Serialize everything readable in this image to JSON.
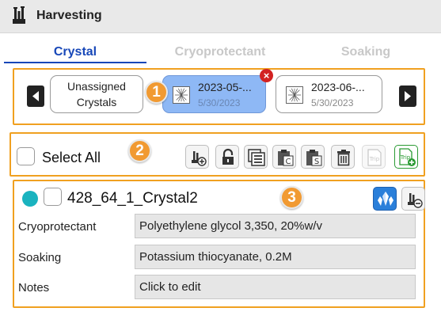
{
  "window": {
    "title": "Harvesting",
    "app_icon": "flask-rack-icon"
  },
  "tabs": [
    {
      "label": "Crystal",
      "active": true
    },
    {
      "label": "Cryoprotectant",
      "active": false
    },
    {
      "label": "Soaking",
      "active": false
    }
  ],
  "accent_color": "#1747b8",
  "callout_color": "#f19a32",
  "carousel": {
    "callout": "1",
    "cards": [
      {
        "name_line1": "Unassigned",
        "name_line2": "Crystals",
        "selected": false
      },
      {
        "name": "2023-05-...",
        "date": "5/30/2023",
        "selected": true,
        "remove": "×"
      },
      {
        "name": "2023-06-...",
        "date": "5/30/2023",
        "selected": false
      }
    ]
  },
  "toolbar": {
    "callout": "2",
    "select_all_label": "Select All",
    "tools": [
      {
        "icon": "add-crystal-icon",
        "enabled": true
      },
      {
        "icon": "lock-icon",
        "enabled": true
      },
      {
        "icon": "copy-list-icon",
        "enabled": true
      },
      {
        "icon": "clipboard-c-icon",
        "enabled": true
      },
      {
        "icon": "clipboard-s-icon",
        "enabled": true
      },
      {
        "icon": "trash-icon",
        "enabled": true
      },
      {
        "icon": "trip-icon",
        "label": "Trip",
        "enabled": false
      },
      {
        "icon": "add-trip-icon",
        "label": "Trip",
        "enabled": true
      }
    ]
  },
  "crystal": {
    "callout": "3",
    "name": "428_64_1_Crystal2",
    "status_color": "#1ab3bf",
    "fields": [
      {
        "label": "Cryoprotectant",
        "value": "Polyethylene glycol 3,350, 20%w/v"
      },
      {
        "label": "Soaking",
        "value": "Potassium thiocyanate, 0.2M"
      },
      {
        "label": "Notes",
        "value": "Click to edit"
      }
    ]
  }
}
